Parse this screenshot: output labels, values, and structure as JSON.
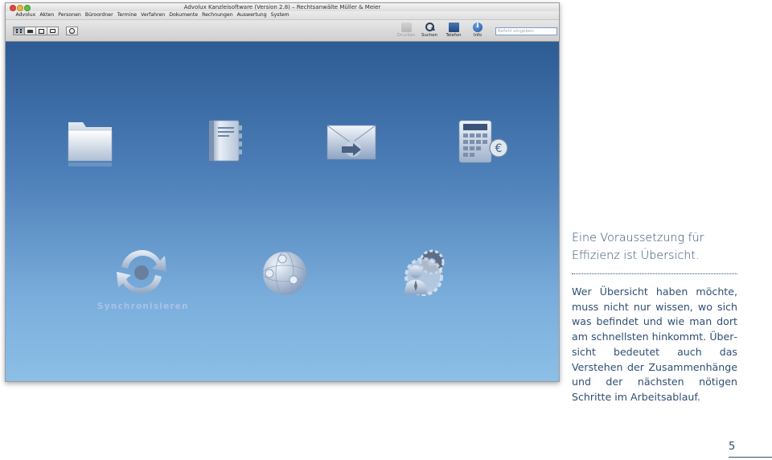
{
  "window": {
    "title": "Advolux Kanzleisoftware (Version 2.8) – Rechtsanwälte Müller & Meier"
  },
  "menu": [
    "Advolux",
    "Akten",
    "Personen",
    "Büroordner",
    "Termine",
    "Verfahren",
    "Dokumente",
    "Rechnungen",
    "Auswertung",
    "System"
  ],
  "toolbar": {
    "view_buttons": [
      "grid-view-icon",
      "folder-view-icon",
      "panel-view-icon",
      "cards-view-icon"
    ],
    "clock_icon": "clock-icon",
    "print_label": "Drucken",
    "search_label": "Suchen",
    "phone_label": "Telefon",
    "info_label": "Info",
    "quick_search_placeholder": "Befehl eingeben"
  },
  "tiles": {
    "sync_label": "Synchronisieren"
  },
  "colors": {
    "accent_blue": "#2d5b94",
    "text_blue": "#2f4f74"
  },
  "text": {
    "headline_line1": "Eine Voraussetzung für",
    "headline_line2": "Effizienz ist Übersicht.",
    "body": "Wer Übersicht haben möchte, muss nicht nur wissen, wo sich was befindet und wie man dort am schnellsten hinkommt. Über­sicht bedeutet auch das Verstehen der Zusammenhänge und der nächsten nötigen Schritte im Arbeitsablauf.",
    "page_number": "5"
  }
}
